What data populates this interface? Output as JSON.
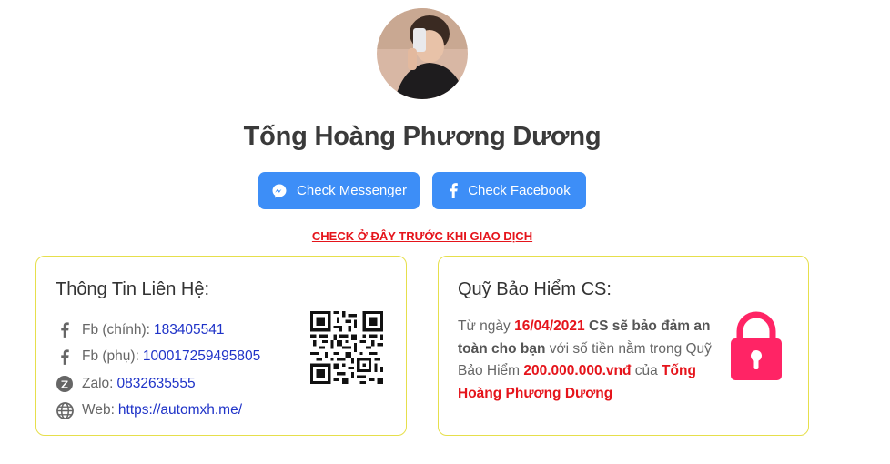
{
  "profile": {
    "name": "Tống Hoàng Phương Dương"
  },
  "buttons": {
    "messenger_label": "Check Messenger",
    "facebook_label": "Check Facebook"
  },
  "check_link": "CHECK Ở ĐÂY TRƯỚC KHI GIAO DỊCH",
  "contact": {
    "title": "Thông Tin Liên Hệ:",
    "rows": [
      {
        "icon": "facebook-icon",
        "label": "Fb (chính):",
        "value": "183405541"
      },
      {
        "icon": "facebook-icon",
        "label": "Fb (phụ):",
        "value": "100017259495805"
      },
      {
        "icon": "zalo-icon",
        "label": "Zalo:",
        "value": "0832635555"
      },
      {
        "icon": "globe-icon",
        "label": "Web:",
        "value": "https://automxh.me/"
      }
    ]
  },
  "insurance": {
    "title": "Quỹ Bảo Hiểm CS:",
    "text_1": "Từ ngày ",
    "date": "16/04/2021",
    "text_2": " CS sẽ bảo đảm an toàn cho bạn",
    "text_3": " với số tiền nằm trong Quỹ Bảo Hiểm ",
    "amount": "200.000.000.vnđ",
    "text_4": " của ",
    "owner": "Tống Hoàng Phương Dương"
  },
  "colors": {
    "button_blue": "#3d8ef7",
    "alert_red": "#e5141b",
    "card_border": "#e6df4c",
    "lock_pink": "#ff2465",
    "link_blue": "#1f33c8"
  }
}
